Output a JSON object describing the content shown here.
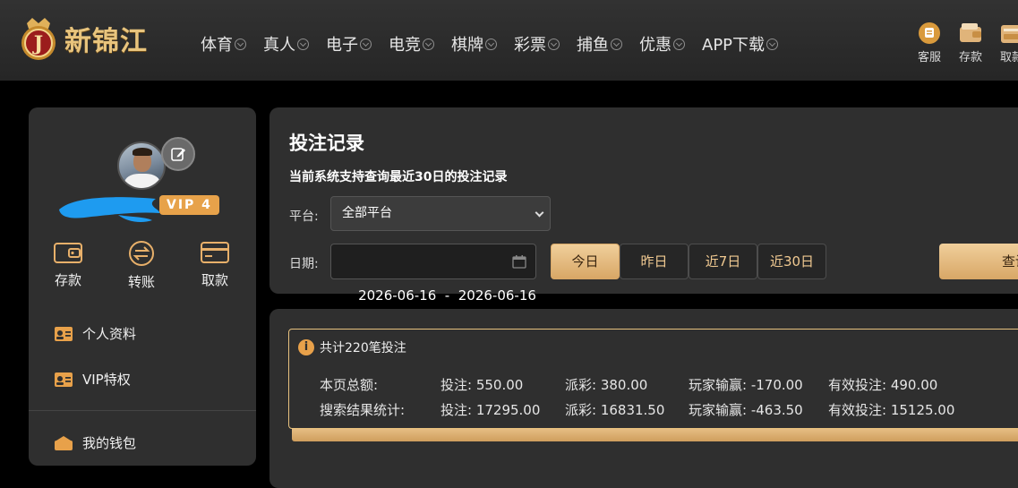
{
  "header": {
    "logo_text": "新锦江",
    "nav": [
      {
        "label": "体育"
      },
      {
        "label": "真人"
      },
      {
        "label": "电子"
      },
      {
        "label": "电竞"
      },
      {
        "label": "棋牌"
      },
      {
        "label": "彩票"
      },
      {
        "label": "捕鱼"
      },
      {
        "label": "优惠"
      },
      {
        "label": "APP下载"
      }
    ],
    "actions": [
      {
        "label": "客服",
        "icon": "customer-service-icon"
      },
      {
        "label": "存款",
        "icon": "wallet-icon"
      },
      {
        "label": "取款",
        "icon": "safe-box-icon"
      }
    ]
  },
  "sidebar": {
    "vip_badge": "VIP 4",
    "quick_actions": [
      {
        "label": "存款",
        "icon": "wallet-icon"
      },
      {
        "label": "转账",
        "icon": "transfer-icon"
      },
      {
        "label": "取款",
        "icon": "card-icon"
      }
    ],
    "menu": [
      {
        "label": "个人资料",
        "icon": "id-card-icon"
      },
      {
        "label": "VIP特权",
        "icon": "id-card-icon"
      },
      {
        "label": "我的钱包",
        "icon": "wallet-icon"
      }
    ]
  },
  "query": {
    "title": "投注记录",
    "subtitle": "当前系统支持查询最近30日的投注记录",
    "platform_label": "平台:",
    "platform_value": "全部平台",
    "date_label": "日期:",
    "date_range": "2026-06-16  -  2026-06-16",
    "quick_dates": [
      "今日",
      "昨日",
      "近7日",
      "近30日"
    ],
    "quick_dates_active": "今日",
    "search_label": "查询"
  },
  "summary": {
    "total_text": "共计220笔投注",
    "rows": [
      {
        "label": "本页总额:",
        "bet": "投注: 550.00",
        "payout": "派彩: 380.00",
        "win_loss": "玩家输赢: -170.00",
        "valid": "有效投注: 490.00"
      },
      {
        "label": "搜索结果统计:",
        "bet": "投注: 17295.00",
        "payout": "派彩: 16831.50",
        "win_loss": "玩家输赢: -463.50",
        "valid": "有效投注: 15125.00"
      }
    ]
  },
  "colors": {
    "accent_gold": "#e8c27f",
    "vip_orange": "#e7a24a",
    "panel": "#2f2f2f"
  }
}
